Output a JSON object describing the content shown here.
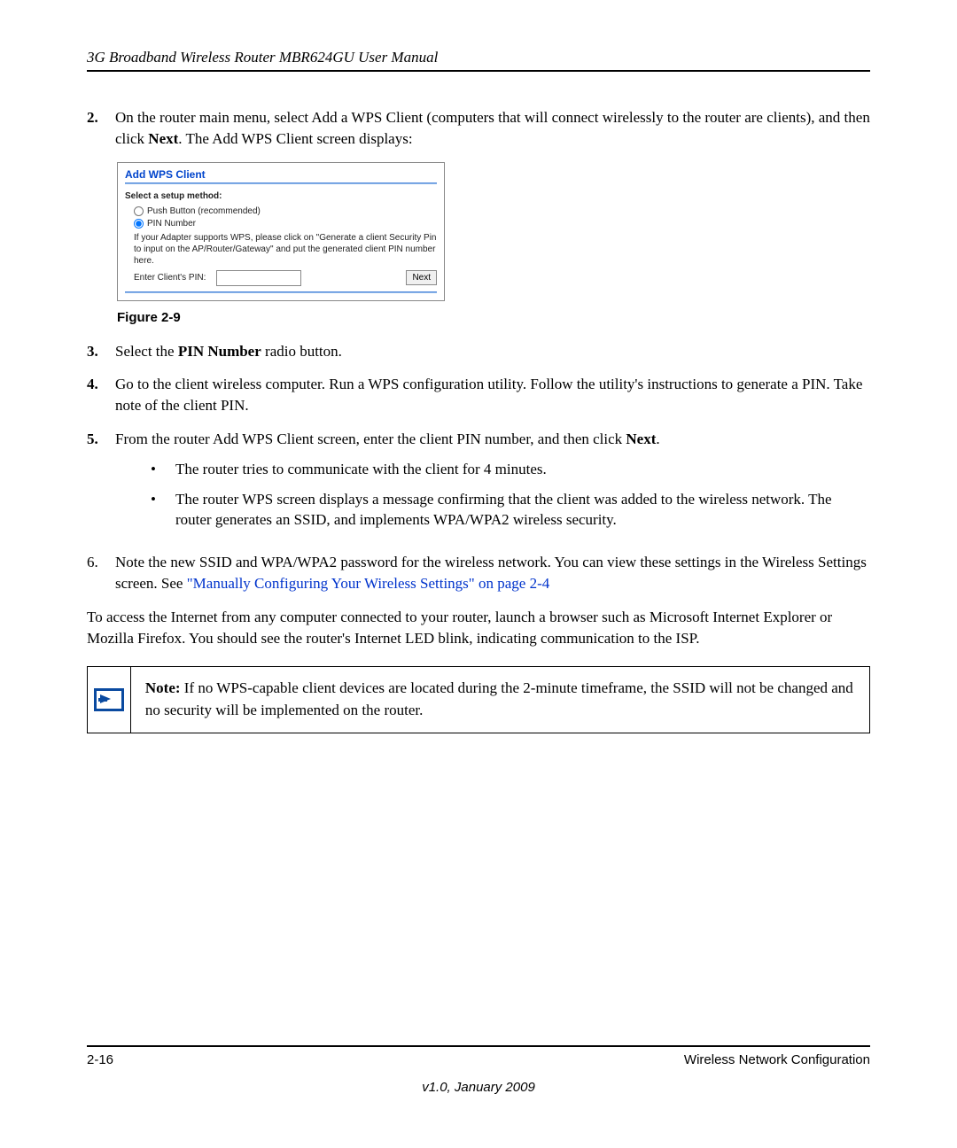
{
  "header": {
    "title": "3G Broadband Wireless Router MBR624GU User Manual"
  },
  "steps": {
    "s2": {
      "num": "2.",
      "text_a": "On the router main menu, select Add a WPS Client (computers that will connect wirelessly to the router are clients), and then click ",
      "bold_a": "Next",
      "text_b": ". The Add WPS Client screen displays:"
    },
    "s3": {
      "num": "3.",
      "text_a": "Select the ",
      "bold_a": "PIN Number",
      "text_b": " radio button."
    },
    "s4": {
      "num": "4.",
      "text": "Go to the client wireless computer. Run a WPS configuration utility. Follow the utility's instructions to generate a PIN. Take note of the client PIN."
    },
    "s5": {
      "num": "5.",
      "text_a": "From the router Add WPS Client screen, enter the client PIN number, and then click ",
      "bold_a": "Next",
      "text_b": ".",
      "b1": "The router tries to communicate with the client for 4 minutes.",
      "b2": "The router WPS screen displays a message confirming that the client was added to the wireless network. The router generates an SSID, and implements WPA/WPA2 wireless security."
    },
    "s6": {
      "num": "6.",
      "text_a": "Note the new SSID and WPA/WPA2 password for the wireless network. You can view these settings in the Wireless Settings screen. See ",
      "link": "\"Manually Configuring Your Wireless Settings\" on page 2-4"
    }
  },
  "figure": {
    "caption": "Figure 2-9",
    "panel_title": "Add WPS Client",
    "select_label": "Select a setup method:",
    "radio1": "Push Button (recommended)",
    "radio2": "PIN Number",
    "help": "If your Adapter supports WPS, please click on \"Generate a client Security Pin to input on the AP/Router/Gateway\" and put the generated client PIN number here.",
    "pin_label": "Enter Client's PIN:",
    "next_btn": "Next"
  },
  "paragraph": "To access the Internet from any computer connected to your router, launch a browser such as Microsoft Internet Explorer or Mozilla Firefox. You should see the router's Internet LED blink, indicating communication to the ISP.",
  "note": {
    "label": "Note:",
    "text": " If no WPS-capable client devices are located during the 2-minute timeframe, the SSID will not be changed and no security will be implemented on the router."
  },
  "footer": {
    "page": "2-16",
    "section": "Wireless Network Configuration",
    "version": "v1.0, January 2009"
  }
}
